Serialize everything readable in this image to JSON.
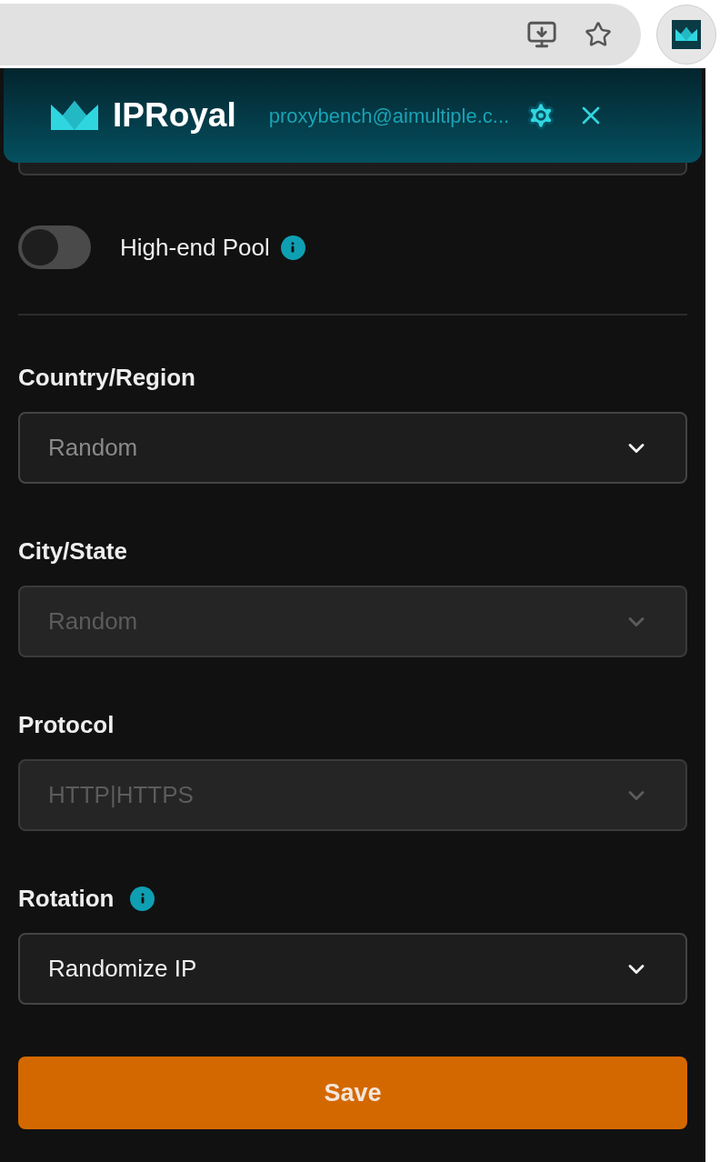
{
  "header": {
    "brand": "IPRoyal",
    "account": "proxybench@aimultiple.c..."
  },
  "pool_toggle": {
    "label": "High-end Pool",
    "on": false,
    "info": true
  },
  "fields": [
    {
      "label": "Country/Region",
      "info": false,
      "placeholder": "Random",
      "disabled": false
    },
    {
      "label": "City/State",
      "info": false,
      "placeholder": "Random",
      "disabled": true
    },
    {
      "label": "Protocol",
      "info": false,
      "value": "HTTP|HTTPS",
      "disabled": true
    },
    {
      "label": "Rotation",
      "info": true,
      "value": "Randomize IP",
      "disabled": false
    }
  ],
  "save_button": "Save"
}
